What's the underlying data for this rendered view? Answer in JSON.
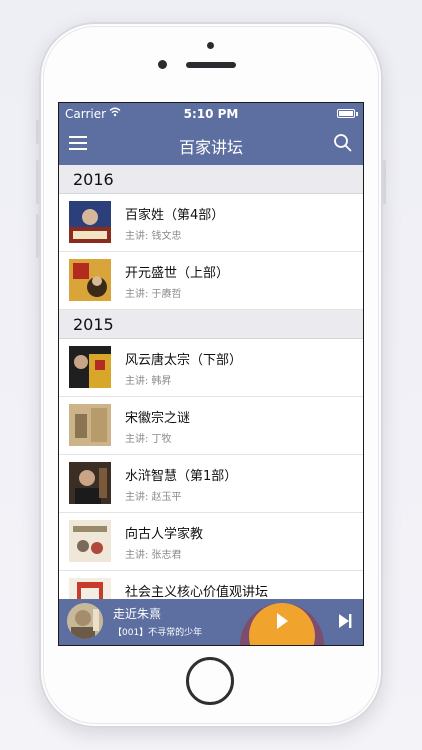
{
  "status_bar": {
    "carrier": "Carrier",
    "wifi": "wifi-icon",
    "time": "5:10 PM",
    "battery": "battery-icon"
  },
  "header": {
    "title": "百家讲坛",
    "menu_icon": "menu-icon",
    "search_icon": "search-icon"
  },
  "colors": {
    "accent": "#5d6fa0",
    "play_button": "#f0a42e",
    "play_ring": "#7d4d70",
    "subtitle": "#8a8a8a"
  },
  "sections": [
    {
      "year": "2016",
      "items": [
        {
          "title": "百家姓（第4部）",
          "subtitle": "主讲: 钱文忠"
        },
        {
          "title": "开元盛世（上部）",
          "subtitle": "主讲: 于赓哲"
        }
      ]
    },
    {
      "year": "2015",
      "items": [
        {
          "title": "风云唐太宗（下部）",
          "subtitle": "主讲: 韩昇"
        },
        {
          "title": "宋徽宗之谜",
          "subtitle": "主讲: 丁牧"
        },
        {
          "title": "水浒智慧（第1部）",
          "subtitle": "主讲: 赵玉平"
        },
        {
          "title": "向古人学家教",
          "subtitle": "主讲: 张志君"
        },
        {
          "title": "社会主义核心价值观讲坛",
          "subtitle": ""
        }
      ]
    }
  ],
  "player": {
    "title": "走近朱熹",
    "subtitle": "【001】不寻常的少年",
    "play_icon": "play-icon",
    "next_icon": "skip-next-icon"
  }
}
